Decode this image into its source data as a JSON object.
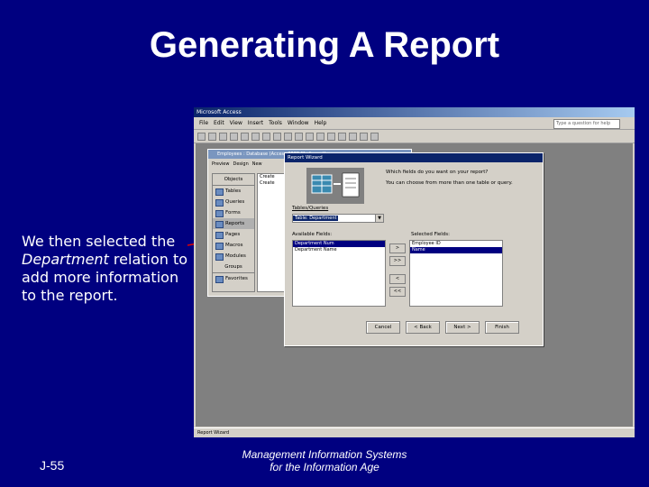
{
  "slide": {
    "title": "Generating A Report",
    "caption_before": "We then selected the",
    "caption_emph": "Department",
    "caption_after": "relation to add more information to the report.",
    "slide_number": "J-55",
    "footer_line1": "Management Information Systems",
    "footer_line2": "for the Information Age"
  },
  "access": {
    "title": "Microsoft Access",
    "menu": [
      "File",
      "Edit",
      "View",
      "Insert",
      "Tools",
      "Window",
      "Help"
    ],
    "ask_placeholder": "Type a question for help",
    "status": "Report Wizard",
    "db_window": {
      "title": "Employees : Database (Access 2000 file format)",
      "toolbar": [
        "Preview",
        "Design",
        "New"
      ],
      "objects_header": "Objects",
      "objects": [
        "Tables",
        "Queries",
        "Forms",
        "Reports",
        "Pages",
        "Macros",
        "Modules"
      ],
      "groups_header": "Groups",
      "groups": [
        "Favorites"
      ],
      "list_items": [
        "Create",
        "Create"
      ]
    },
    "wizard": {
      "title": "Report Wizard",
      "question": "Which fields do you want on your report?",
      "hint": "You can choose from more than one table or query.",
      "tables_label": "Tables/Queries",
      "tables_value": "Table: Department",
      "available_label": "Available Fields:",
      "selected_label": "Selected Fields:",
      "available_fields": [
        "Department Num",
        "Department Name"
      ],
      "selected_fields": [
        "Employee ID",
        "Name"
      ],
      "move_buttons": [
        ">",
        ">>",
        "<",
        "<<"
      ],
      "buttons": [
        "Cancel",
        "< Back",
        "Next >",
        "Finish"
      ]
    }
  }
}
